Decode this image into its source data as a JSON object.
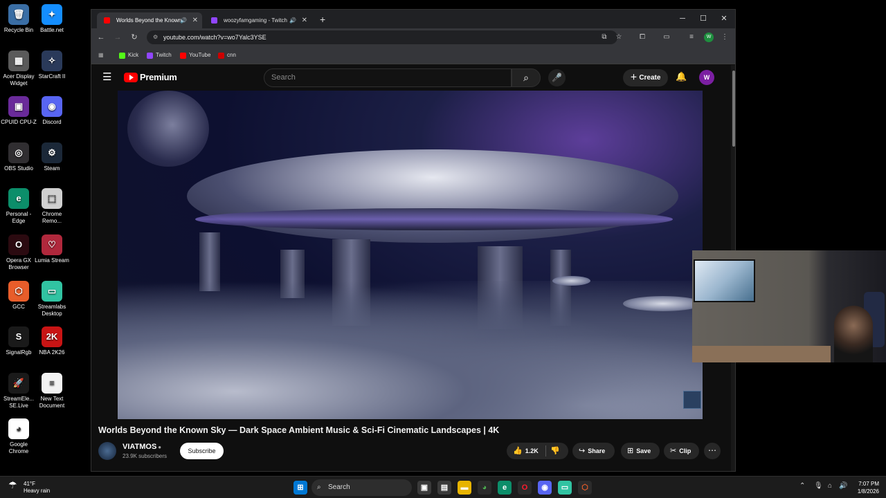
{
  "desktop": {
    "icons": [
      {
        "label": "Recycle Bin",
        "color": "#3a6ea5",
        "glyph": "🗑"
      },
      {
        "label": "Battle.net",
        "color": "#148eff",
        "glyph": "✦"
      },
      {
        "label": "Acer Display Widget",
        "color": "#5a5a5a",
        "glyph": "▦"
      },
      {
        "label": "StarCraft II",
        "color": "#2a3a5a",
        "glyph": "✧"
      },
      {
        "label": "CPUID CPU-Z",
        "color": "#6a2a9a",
        "glyph": "▣"
      },
      {
        "label": "Discord",
        "color": "#5865f2",
        "glyph": "◉"
      },
      {
        "label": "OBS Studio",
        "color": "#302e31",
        "glyph": "◎"
      },
      {
        "label": "Steam",
        "color": "#1b2838",
        "glyph": "⚙"
      },
      {
        "label": "Personal - Edge",
        "color": "#0c8e6a",
        "glyph": "e"
      },
      {
        "label": "Chrome Remo...",
        "color": "#d0d0d0",
        "glyph": "⬚"
      },
      {
        "label": "Opera GX Browser",
        "color": "#2b0a10",
        "glyph": "O"
      },
      {
        "label": "Lumia Stream",
        "color": "#b0283c",
        "glyph": "♡"
      },
      {
        "label": "GCC",
        "color": "#e85d2a",
        "glyph": "⬡"
      },
      {
        "label": "Streamlabs Desktop",
        "color": "#31c3a2",
        "glyph": "▭"
      },
      {
        "label": "SignalRgb",
        "color": "#1a1a1a",
        "glyph": "S"
      },
      {
        "label": "NBA 2K26",
        "color": "#c81414",
        "glyph": "2K"
      },
      {
        "label": "StreamEle... SE.Live",
        "color": "#1a1a1a",
        "glyph": "🚀"
      },
      {
        "label": "New Text Document",
        "color": "#f2f2f2",
        "glyph": "≡"
      },
      {
        "label": "Google Chrome",
        "color": "#ffffff",
        "glyph": "◕"
      }
    ]
  },
  "browser": {
    "tabs": [
      {
        "title": "Worlds Beyond the Known",
        "favicon_color": "#ff0000"
      },
      {
        "title": "woozyfamgaming - Twitch",
        "favicon_color": "#9146ff"
      }
    ],
    "new_tab": "+",
    "window_controls": {
      "minimize": "─",
      "maximize": "☐",
      "close": "✕"
    },
    "nav": {
      "back": "←",
      "forward": "→",
      "reload": "↻"
    },
    "url": "youtube.com/watch?v=wo7Yalc3YSE",
    "profile_initial": "W",
    "bookmarks": [
      {
        "label": "Kick",
        "color": "#53fc18"
      },
      {
        "label": "Twitch",
        "color": "#9146ff"
      },
      {
        "label": "YouTube",
        "color": "#ff0000"
      },
      {
        "label": "cnn",
        "color": "#cc0000"
      }
    ]
  },
  "youtube": {
    "brand": "Premium",
    "search_placeholder": "Search",
    "create_label": "Create",
    "avatar_initial": "W",
    "video": {
      "title": "Worlds Beyond the Known Sky — Dark Space Ambient Music & Sci-Fi Cinematic Landscapes | 4K",
      "channel": "VIATMOS",
      "subscribers": "23.9K subscribers",
      "subscribe_label": "Subscribe",
      "likes": "1.2K",
      "share_label": "Share",
      "save_label": "Save",
      "clip_label": "Clip"
    }
  },
  "taskbar": {
    "weather_temp": "41°F",
    "weather_desc": "Heavy rain",
    "search_label": "Search",
    "time": "7:07 PM",
    "date": "1/8/2026"
  }
}
